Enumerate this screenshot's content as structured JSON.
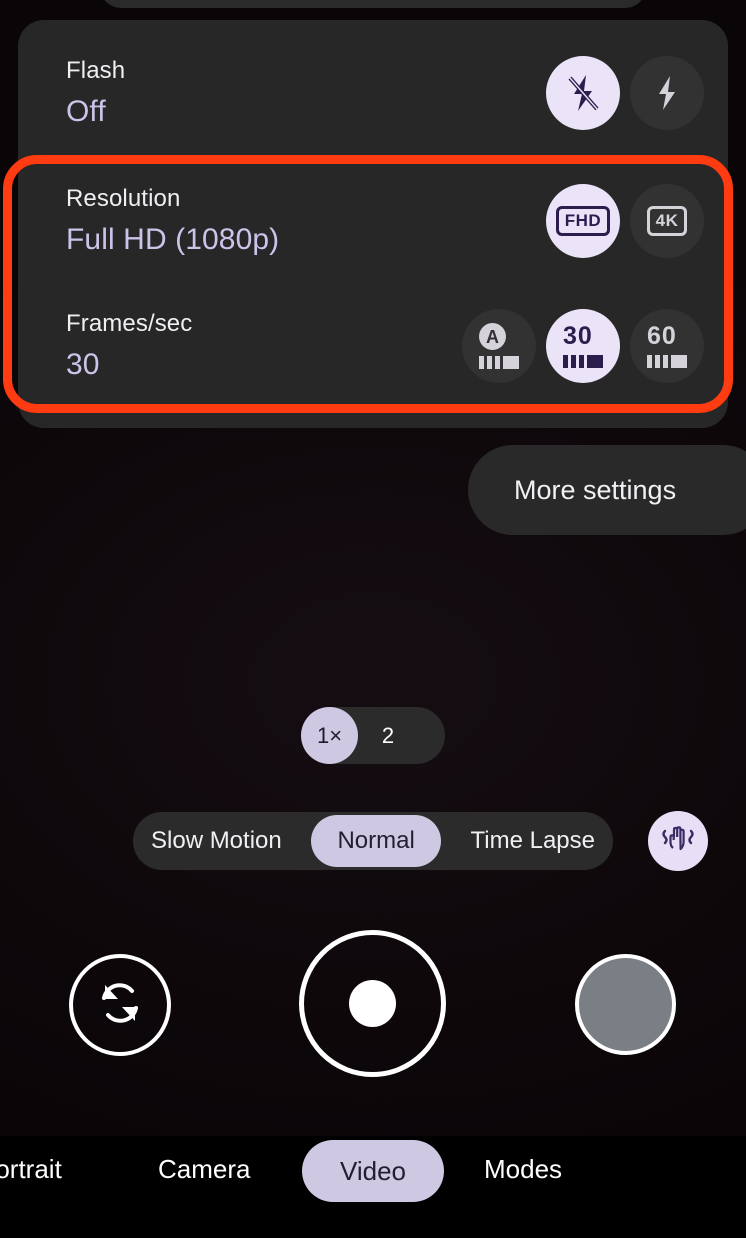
{
  "app": {
    "name": "Camera",
    "accent_lavender": "#cfc8e3",
    "accent_chip_bg": "#ebe3f8",
    "accent_ink": "#2b1d4d",
    "panel_bg": "#272727",
    "annotation_color": "#ff3b11"
  },
  "settings_panel": {
    "rows": [
      {
        "id": "flash",
        "label": "Flash",
        "value": "Off",
        "options": [
          {
            "id": "flash-off",
            "icon": "flash-off-icon",
            "selected": true
          },
          {
            "id": "flash-on",
            "icon": "flash-on-icon",
            "selected": false
          }
        ]
      },
      {
        "id": "resolution",
        "label": "Resolution",
        "value": "Full HD (1080p)",
        "options": [
          {
            "id": "res-fhd",
            "icon": "fhd-badge-icon",
            "badge": "FHD",
            "selected": true
          },
          {
            "id": "res-4k",
            "icon": "4k-badge-icon",
            "badge": "4K",
            "selected": false
          }
        ]
      },
      {
        "id": "fps",
        "label": "Frames/sec",
        "value": "30",
        "options": [
          {
            "id": "fps-auto",
            "icon": "fps-auto-icon",
            "badge": "A",
            "selected": false
          },
          {
            "id": "fps-30",
            "icon": "fps-30-icon",
            "badge": "30",
            "selected": true
          },
          {
            "id": "fps-60",
            "icon": "fps-60-icon",
            "badge": "60",
            "selected": false
          }
        ]
      }
    ]
  },
  "more_settings": {
    "label": "More settings"
  },
  "zoom_control": {
    "options": [
      {
        "id": "zoom-1x",
        "label": "1×",
        "selected": true
      },
      {
        "id": "zoom-2x",
        "label": "2",
        "selected": false
      }
    ]
  },
  "mode_selector": {
    "options": [
      {
        "id": "slow-motion",
        "label": "Slow Motion",
        "selected": false
      },
      {
        "id": "normal",
        "label": "Normal",
        "selected": true
      },
      {
        "id": "time-lapse",
        "label": "Time Lapse",
        "selected": false
      }
    ]
  },
  "stabilization": {
    "icon": "hand-stabilization-icon",
    "active": true
  },
  "shutter_row": {
    "flip_camera": {
      "icon": "camera-flip-icon"
    },
    "record": {
      "icon": "record-button-icon"
    },
    "gallery": {
      "icon": "gallery-thumbnail"
    }
  },
  "bottom_tabs": {
    "items": [
      {
        "id": "portrait",
        "label": "Portrait",
        "selected": false
      },
      {
        "id": "camera",
        "label": "Camera",
        "selected": false
      },
      {
        "id": "video",
        "label": "Video",
        "selected": true
      },
      {
        "id": "modes",
        "label": "Modes",
        "selected": false
      }
    ]
  }
}
